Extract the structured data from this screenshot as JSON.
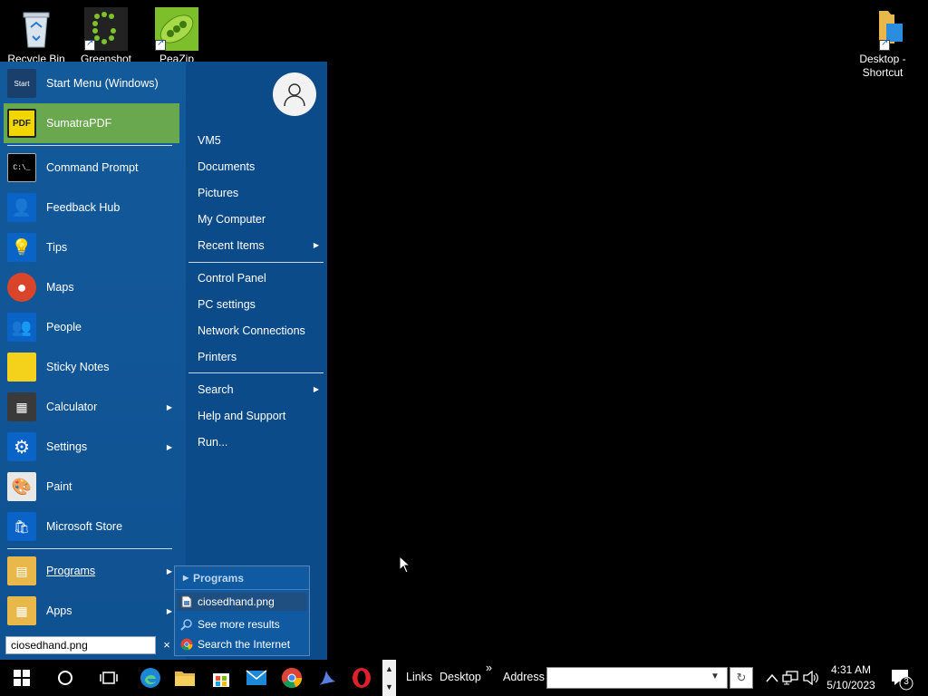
{
  "desktop": {
    "icons": [
      {
        "label": "Recycle Bin",
        "icon": "recycle-bin-icon"
      },
      {
        "label": "Greenshot",
        "icon": "greenshot-icon"
      },
      {
        "label": "PeaZip",
        "icon": "peazip-icon"
      },
      {
        "label": "Desktop - Shortcut",
        "icon": "folder-shortcut-icon"
      }
    ]
  },
  "start_menu": {
    "pinned": [
      {
        "label": "Start Menu (Windows)",
        "icon": "start-menu-icon"
      },
      {
        "label": "SumatraPDF",
        "icon": "sumatrapdf-icon"
      }
    ],
    "recent": [
      {
        "label": "Command Prompt",
        "icon": "command-prompt-icon"
      },
      {
        "label": "Feedback Hub",
        "icon": "feedback-hub-icon"
      },
      {
        "label": "Tips",
        "icon": "tips-icon"
      },
      {
        "label": "Maps",
        "icon": "maps-icon"
      },
      {
        "label": "People",
        "icon": "people-icon"
      },
      {
        "label": "Sticky Notes",
        "icon": "sticky-notes-icon"
      },
      {
        "label": "Calculator",
        "icon": "calculator-icon"
      },
      {
        "label": "Settings",
        "icon": "settings-icon"
      },
      {
        "label": "Paint",
        "icon": "paint-icon"
      },
      {
        "label": "Microsoft Store",
        "icon": "microsoft-store-icon"
      }
    ],
    "bottom": [
      {
        "label": "Programs",
        "icon": "programs-icon"
      },
      {
        "label": "Apps",
        "icon": "apps-icon"
      }
    ],
    "right_group1": [
      "VM5",
      "Documents",
      "Pictures",
      "My Computer",
      "Recent Items"
    ],
    "right_group2": [
      "Control Panel",
      "PC settings",
      "Network Connections",
      "Printers"
    ],
    "right_group3": [
      "Search",
      "Help and Support",
      "Run..."
    ],
    "search_value": "ciosedhand.png",
    "search_clear": "×"
  },
  "search_results": {
    "header": "Programs",
    "items": [
      "ciosedhand.png",
      "See more results",
      "Search the Internet"
    ]
  },
  "taskbar": {
    "links_label": "Links",
    "desktop_label": "Desktop",
    "chevron": "»",
    "address_label": "Address",
    "address_value": "",
    "time": "4:31 AM",
    "date": "5/10/2023",
    "notification_count": "3"
  }
}
